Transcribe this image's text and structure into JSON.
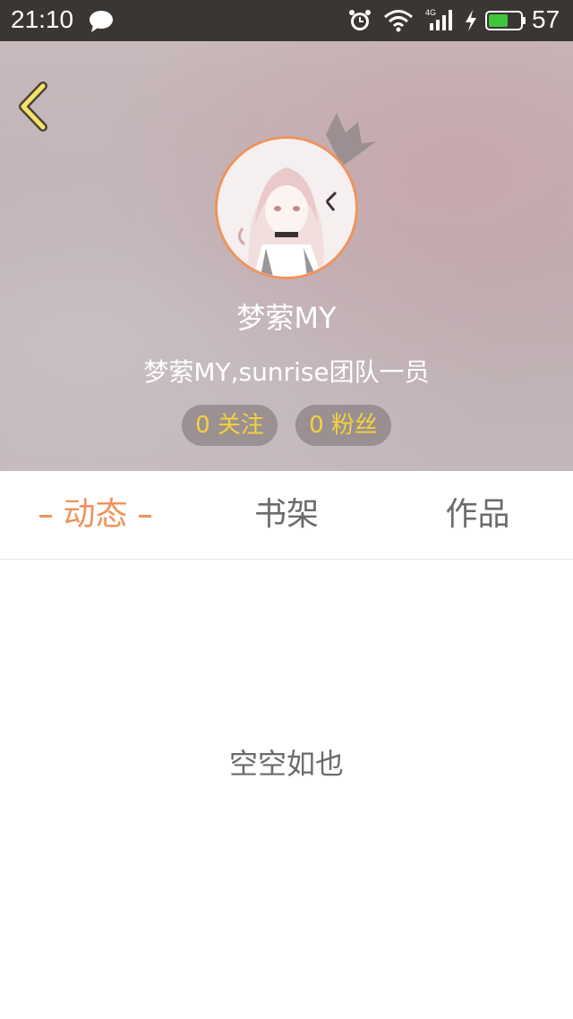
{
  "status_bar": {
    "time": "21:10",
    "network": "4G",
    "battery_level": "57",
    "icons": [
      "message-icon",
      "alarm-icon",
      "wifi-icon",
      "signal-icon",
      "charging-icon",
      "battery-icon"
    ]
  },
  "profile": {
    "username": "梦萦MY",
    "bio": "梦萦MY,sunrise团队一员",
    "following": "0 关注",
    "fans": "0 粉丝"
  },
  "tabs": [
    {
      "label": "动态",
      "active": true
    },
    {
      "label": "书架",
      "active": false
    },
    {
      "label": "作品",
      "active": false
    }
  ],
  "empty_state": "空空如也",
  "colors": {
    "accent": "#f0935a",
    "pill_text": "#f2d33a",
    "status_bar_bg": "#3a3634",
    "tab_inactive": "#6b6b6b"
  }
}
